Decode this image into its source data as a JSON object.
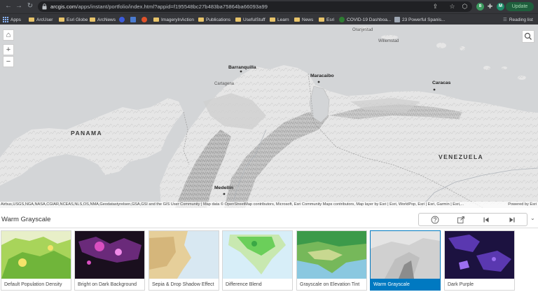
{
  "browser": {
    "url_host": "arcgis.com",
    "url_path": "/apps/instant/portfolio/index.html?appid=f195548bc27b483ba75864ba66093a99",
    "update_label": "Update",
    "profile_initial": "M",
    "reading_list_label": "Reading list",
    "bookmarks": [
      {
        "label": "Apps",
        "icon": "apps-grid-icon"
      },
      {
        "label": "ArcUser",
        "icon": "folder-icon"
      },
      {
        "label": "Esri Globe",
        "icon": "folder-icon"
      },
      {
        "label": "ArcNews",
        "icon": "folder-icon"
      },
      {
        "label": "ImageryInAction",
        "icon": "folder-icon"
      },
      {
        "label": "Publications",
        "icon": "folder-icon"
      },
      {
        "label": "UsefulStuff",
        "icon": "folder-icon"
      },
      {
        "label": "Learn",
        "icon": "folder-icon"
      },
      {
        "label": "News",
        "icon": "folder-icon"
      },
      {
        "label": "Esri",
        "icon": "folder-icon"
      },
      {
        "label": "COVID-19 Dashboa...",
        "icon": "covid-favicon"
      },
      {
        "label": "23 Powerful Spanis...",
        "icon": "page-favicon"
      }
    ]
  },
  "map": {
    "labels": {
      "panama": "PANAMA",
      "venezuela": "VENEZUELA",
      "barranquilla": "Barranquilla",
      "maracaibo": "Maracaibo",
      "caracas": "Caracas",
      "medellin": "Medellín",
      "cartagena": "Cartagena",
      "oranjestad": "Oranjestad",
      "willemstad": "Willemstad"
    },
    "attribution": "Airbus,USGS,NGA,NASA,CGIAR,NCEAS,NLS,OS,NMA,Geodatastyrelsen,GSA,GSI and the GIS User Community | Map data © OpenStreetMap contributors, Microsoft, Esri Community Maps contributors, Map layer by Esri | Esri, WorldPop, Esri | Esri, Garmin | Esri,...",
    "powered_by": "Powered by Esri"
  },
  "panel": {
    "title": "Warm Grayscale",
    "tools": [
      "help-icon",
      "share-icon",
      "previous-icon",
      "next-icon"
    ]
  },
  "gallery": [
    {
      "label": "Default Population Density",
      "selected": false,
      "palette": [
        "#e8efc8",
        "#a8d45a",
        "#58a82c",
        "#f4e36a"
      ]
    },
    {
      "label": "Bright on Dark Background",
      "selected": false,
      "palette": [
        "#1a0f1e",
        "#6a2a7a",
        "#d94fc0",
        "#f08ae8"
      ]
    },
    {
      "label": "Sepia & Drop Shadow Effect",
      "selected": false,
      "palette": [
        "#d8e8f2",
        "#e6cf9a",
        "#c9a568",
        "#f0e0b8"
      ]
    },
    {
      "label": "Difference Blend",
      "selected": false,
      "palette": [
        "#d7eef8",
        "#6bcf5a",
        "#c8e8b0",
        "#3aa845"
      ]
    },
    {
      "label": "Grayscale on Elevation Tint",
      "selected": false,
      "palette": [
        "#8ac8e0",
        "#3c9a4a",
        "#76b85a",
        "#c8d890"
      ]
    },
    {
      "label": "Warm Grayscale",
      "selected": true,
      "palette": [
        "#e4e4e4",
        "#bfbfbf",
        "#8c8c8c",
        "#d0d0d0"
      ]
    },
    {
      "label": "Dark Purple",
      "selected": false,
      "palette": [
        "#1c1240",
        "#5a38b0",
        "#9b6ff0",
        "#2a1d5a"
      ]
    }
  ]
}
